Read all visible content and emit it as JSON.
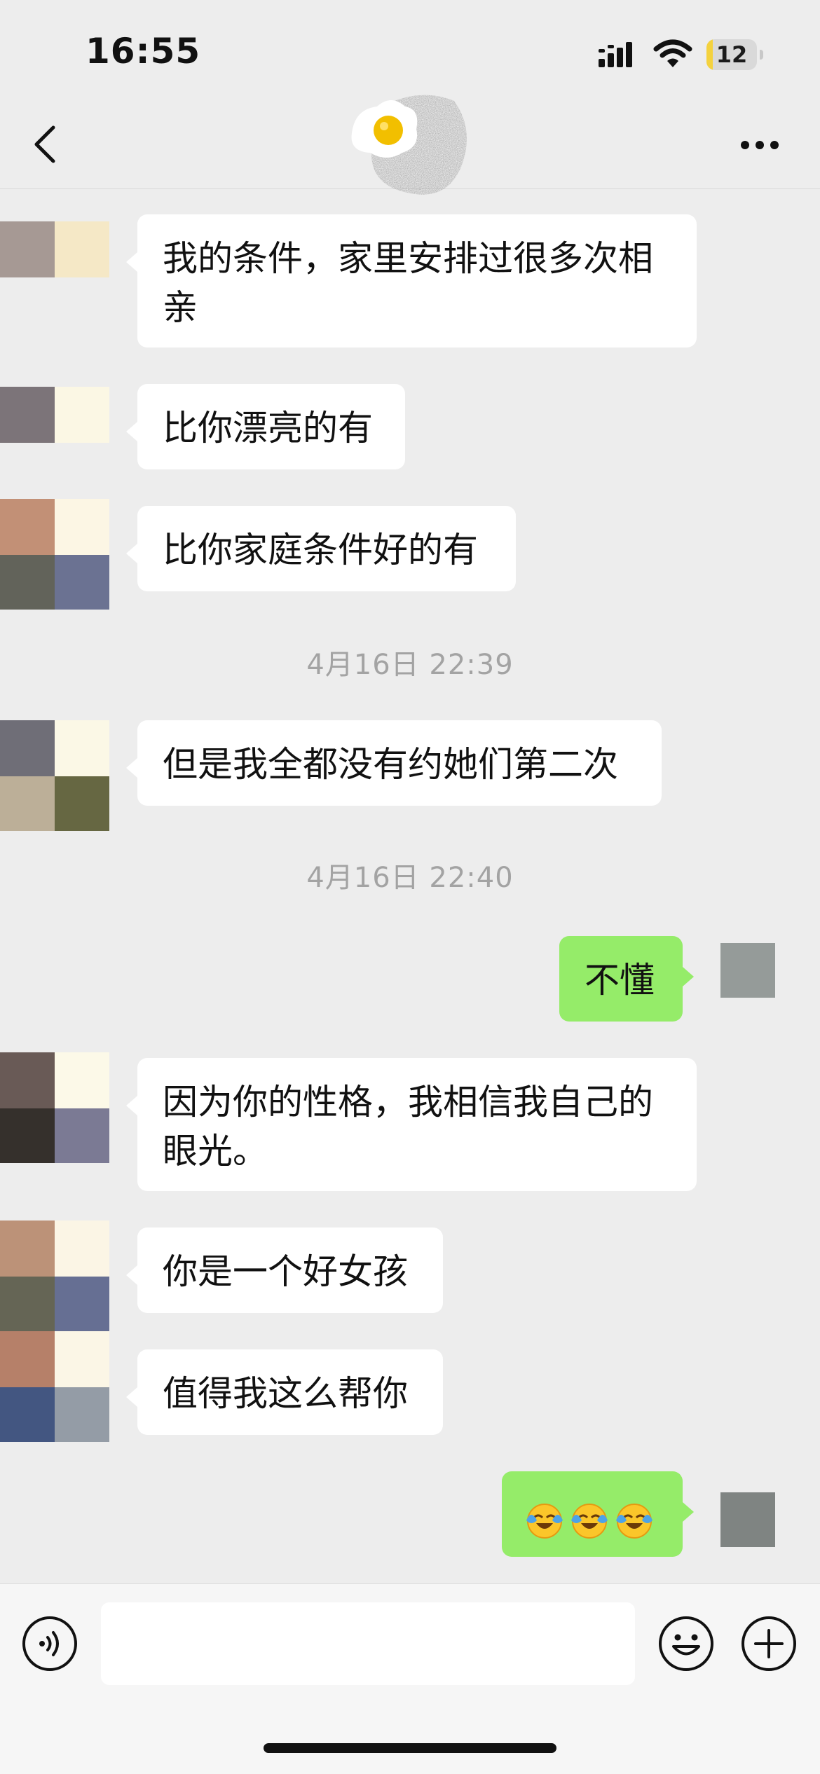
{
  "status_bar": {
    "time": "16:55",
    "battery_level": "12",
    "battery_fraction": 0.12,
    "icons": [
      "signal-icon",
      "wifi-icon",
      "battery-icon"
    ]
  },
  "nav": {
    "back_icon": "chevron-left-icon",
    "more_icon": "ellipsis-icon",
    "avatar_icon": "fried-egg-avatar"
  },
  "chat": {
    "messages": [
      {
        "sender": "contact",
        "text": "我的条件，家里安排过很多次相亲"
      },
      {
        "sender": "contact",
        "text": "比你漂亮的有"
      },
      {
        "sender": "contact",
        "text": "比你家庭条件好的有"
      },
      {
        "timestamp": "4月16日 22:39"
      },
      {
        "sender": "contact",
        "text": "但是我全都没有约她们第二次"
      },
      {
        "timestamp": "4月16日 22:40"
      },
      {
        "sender": "me",
        "text": "不懂"
      },
      {
        "sender": "contact",
        "text": "因为你的性格，我相信我自己的眼光。"
      },
      {
        "sender": "contact",
        "text": "你是一个好女孩"
      },
      {
        "sender": "contact",
        "text": "值得我这么帮你"
      },
      {
        "sender": "me",
        "emoji": [
          "loudly-crying-laughing-emoji",
          "loudly-crying-laughing-emoji",
          "loudly-crying-laughing-emoji"
        ]
      }
    ]
  },
  "colors": {
    "chat_background": "#ededed",
    "incoming_bubble": "#ffffff",
    "outgoing_bubble": "#95ec69",
    "timestamp_text": "#a3a3a3",
    "battery_low": "#f4d23e"
  },
  "input_bar": {
    "message_value": "",
    "icons": [
      "voice-icon",
      "emoji-icon",
      "plus-icon"
    ]
  }
}
